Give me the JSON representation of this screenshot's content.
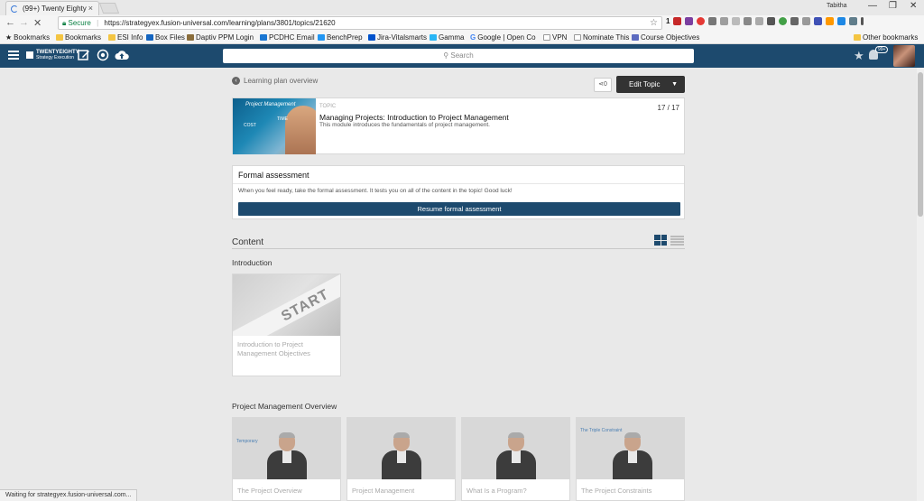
{
  "browser": {
    "tab_title": "(99+) Twenty Eighty",
    "tab_close": "×",
    "user_name": "Tabitha",
    "url_secure": "Secure",
    "url_divider": "|",
    "url": "https://strategyex.fusion-universal.com/learning/plans/3801/topics/21620",
    "bookmark_star": "☆",
    "status_text": "Waiting for strategyex.fusion-universal.com...",
    "win_min": "—",
    "win_max": "❐",
    "win_close": "✕",
    "nav_back": "←",
    "nav_forward": "→",
    "nav_stop": "✕",
    "ext_count": "1",
    "bookmarks_label": "Bookmarks",
    "bookmarks": [
      "Bookmarks",
      "ESI Info",
      "Box Files",
      "Daptiv PPM Login",
      "PCDHC Email",
      "BenchPrep",
      "Jira-Vitalsmarts",
      "Gamma",
      "Google | Open Co",
      "VPN",
      "Nominate This",
      "Course Objectives"
    ],
    "other_bookmarks": "Other bookmarks"
  },
  "header": {
    "logo_name": "TWENTYEIGHTY",
    "logo_sub": "Strategy Execution",
    "search_placeholder": "Search",
    "notifications_badge": "99+"
  },
  "page": {
    "back_link": "Learning plan overview",
    "share_count": "0",
    "edit_topic": "Edit Topic",
    "topic": {
      "image_title": "Project Management",
      "image_time": "TIME",
      "image_cost": "COST",
      "label": "TOPIC",
      "title": "Managing Projects: Introduction to Project Management",
      "description": "This module introduces the fundamentals of project management.",
      "count": "17 / 17"
    },
    "assessment": {
      "title": "Formal assessment",
      "text": "When you feel ready, take the formal assessment. It tests you on all of the content in the topic! Good luck!",
      "button": "Resume formal assessment"
    },
    "content_heading": "Content",
    "sections": [
      {
        "title": "Introduction",
        "cards": [
          {
            "thumb_text": "START",
            "title": "Introduction to Project Management Objectives"
          }
        ]
      },
      {
        "title": "Project Management Overview",
        "cards": [
          {
            "title": "The Project Overview",
            "thumb_tag": "Temporary"
          },
          {
            "title": "Project Management"
          },
          {
            "title": "What Is a Program?"
          },
          {
            "title": "The Project Constraints",
            "thumb_tag": "The Triple Constraint"
          }
        ]
      }
    ]
  }
}
